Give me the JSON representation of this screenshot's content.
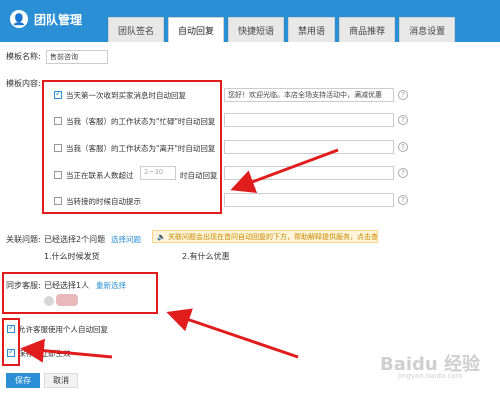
{
  "app": {
    "title": "团队管理"
  },
  "tabs": [
    {
      "label": "团队签名",
      "active": false
    },
    {
      "label": "自动回复",
      "active": true
    },
    {
      "label": "快捷短语",
      "active": false
    },
    {
      "label": "禁用语",
      "active": false
    },
    {
      "label": "商品推荐",
      "active": false
    },
    {
      "label": "消息设置",
      "active": false
    }
  ],
  "form": {
    "template_name_label": "模板名称:",
    "template_name_value": "售前咨询",
    "template_content_label": "模板内容:",
    "options": [
      {
        "label": "当天第一次收到买家消息时自动回复",
        "checked": true,
        "value": "您好！欢迎光临。本店全场支持活动中，满减优惠"
      },
      {
        "label": "当我（客服）的工作状态为\"忙碌\"时自动回复",
        "checked": false,
        "value": ""
      },
      {
        "label": "当我（客服）的工作状态为\"离开\"时自动回复",
        "checked": false,
        "value": ""
      },
      {
        "label_before": "当正在联系人数超过",
        "input_placeholder": "2~30",
        "label_after": "时自动回复",
        "checked": false,
        "value": ""
      },
      {
        "label": "当转接的时候自动提示",
        "checked": false,
        "value": ""
      }
    ],
    "related_label": "关联问题:",
    "related_selected": "已经选择2个问题",
    "related_link": "选择问题",
    "notice": "关联问题会出现在首问自动回复的下方，帮助解释提供服务，点击查看",
    "questions": [
      "1.什么时候发货",
      "2.有什么优惠"
    ],
    "sync_label": "同步客服:",
    "sync_selected": "已经选择1人",
    "sync_link": "重新选择",
    "allow_personal": {
      "label": "允许客服使用个人自动回复",
      "checked": true
    },
    "save_effective": {
      "label": "保存时立即生效",
      "checked": true
    },
    "save_button": "保存",
    "cancel_button": "取消"
  },
  "watermark": {
    "text": "Baidu 经验",
    "sub": "jingyan.baidu.com"
  },
  "colors": {
    "header": "#2a8fd4",
    "highlight": "#e01c1c",
    "link": "#2a8fd4"
  }
}
